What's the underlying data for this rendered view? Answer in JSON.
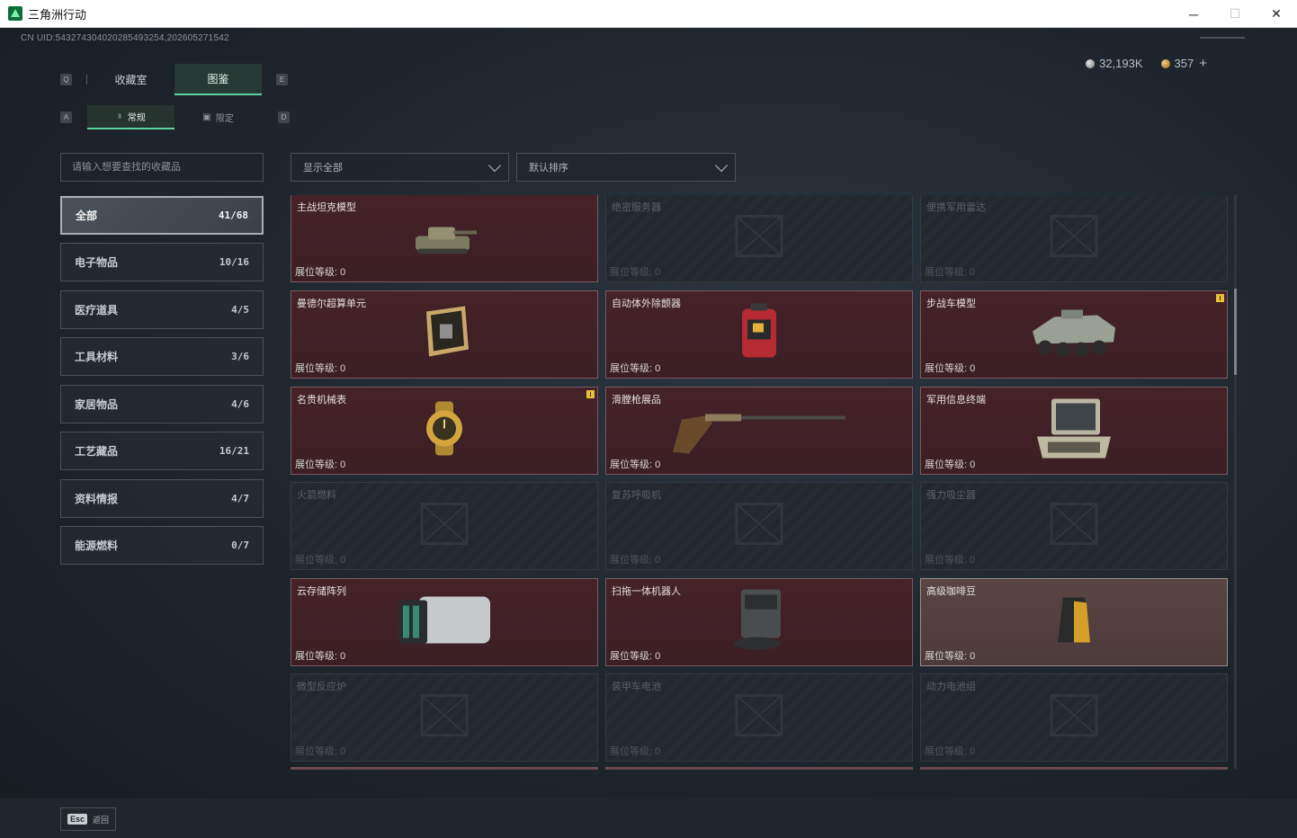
{
  "window": {
    "title": "三角洲行动",
    "minimize": "─",
    "maximize": "☐",
    "close": "✕"
  },
  "header": {
    "uid": "CN UID:543274304020285493254,202605271542",
    "currency": [
      {
        "icon": "silver-coin-icon",
        "value": "32,193K"
      },
      {
        "icon": "gold-coin-icon",
        "value": "357"
      }
    ],
    "add_label": "+"
  },
  "tabs": {
    "main": [
      {
        "label": "收藏室",
        "key": "Q",
        "active": false
      },
      {
        "label": "图鉴",
        "key": "E",
        "active": true
      }
    ],
    "sub": [
      {
        "label": "常规",
        "key": "A",
        "active": true
      },
      {
        "label": "限定",
        "key": "D",
        "active": false
      }
    ]
  },
  "search": {
    "placeholder": "请输入想要查找的收藏品"
  },
  "filters": {
    "show": "显示全部",
    "sort": "默认排序"
  },
  "categories": [
    {
      "label": "全部",
      "count": "41/68",
      "active": true
    },
    {
      "label": "电子物品",
      "count": "10/16",
      "active": false
    },
    {
      "label": "医疗道具",
      "count": "4/5",
      "active": false
    },
    {
      "label": "工具材料",
      "count": "3/6",
      "active": false
    },
    {
      "label": "家居物品",
      "count": "4/6",
      "active": false
    },
    {
      "label": "工艺藏品",
      "count": "16/21",
      "active": false
    },
    {
      "label": "资料情报",
      "count": "4/7",
      "active": false
    },
    {
      "label": "能源燃料",
      "count": "0/7",
      "active": false
    }
  ],
  "items": [
    {
      "name": "主战坦克模型",
      "level": "展位等级: 0",
      "owned": true,
      "alert": false,
      "icon": "tank-icon"
    },
    {
      "name": "绝密服务器",
      "level": "展位等级: 0",
      "owned": false,
      "alert": false,
      "icon": "server-icon"
    },
    {
      "name": "便携军用雷达",
      "level": "展位等级: 0",
      "owned": false,
      "alert": false,
      "icon": "radar-icon"
    },
    {
      "name": "曼德尔超算单元",
      "level": "展位等级: 0",
      "owned": true,
      "alert": false,
      "icon": "computing-unit-icon"
    },
    {
      "name": "自动体外除颤器",
      "level": "展位等级: 0",
      "owned": true,
      "alert": false,
      "icon": "defibrillator-icon"
    },
    {
      "name": "步战车模型",
      "level": "展位等级: 0",
      "owned": true,
      "alert": true,
      "icon": "ifv-icon"
    },
    {
      "name": "名贵机械表",
      "level": "展位等级: 0",
      "owned": true,
      "alert": true,
      "icon": "watch-icon"
    },
    {
      "name": "滑膛枪展品",
      "level": "展位等级: 0",
      "owned": true,
      "alert": false,
      "icon": "musket-icon"
    },
    {
      "name": "军用信息终端",
      "level": "展位等级: 0",
      "owned": true,
      "alert": false,
      "icon": "terminal-icon"
    },
    {
      "name": "火箭燃料",
      "level": "展位等级: 0",
      "owned": false,
      "alert": false,
      "icon": "fuel-icon"
    },
    {
      "name": "复苏呼吸机",
      "level": "展位等级: 0",
      "owned": false,
      "alert": false,
      "icon": "ventilator-icon"
    },
    {
      "name": "强力吸尘器",
      "level": "展位等级: 0",
      "owned": false,
      "alert": false,
      "icon": "vacuum-icon"
    },
    {
      "name": "云存储阵列",
      "level": "展位等级: 0",
      "owned": true,
      "alert": false,
      "icon": "storage-array-icon"
    },
    {
      "name": "扫拖一体机器人",
      "level": "展位等级: 0",
      "owned": true,
      "alert": false,
      "icon": "robot-vacuum-icon"
    },
    {
      "name": "高级咖啡豆",
      "level": "展位等级: 0",
      "owned": true,
      "alert": false,
      "highlight": true,
      "icon": "coffee-bag-icon"
    },
    {
      "name": "微型反应炉",
      "level": "展位等级: 0",
      "owned": false,
      "alert": false,
      "icon": "reactor-icon"
    },
    {
      "name": "装甲车电池",
      "level": "展位等级: 0",
      "owned": false,
      "alert": false,
      "icon": "battery-icon"
    },
    {
      "name": "动力电池组",
      "level": "展位等级: 0",
      "owned": false,
      "alert": false,
      "icon": "battery-pack-icon"
    }
  ],
  "footer": {
    "key": "Esc",
    "label": "返回"
  }
}
